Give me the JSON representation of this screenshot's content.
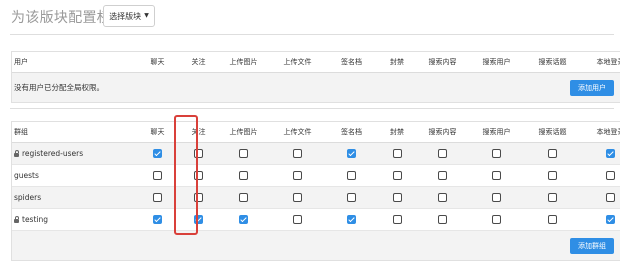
{
  "header": {
    "title": "为该版块配置权限：",
    "select_label": "选择版块"
  },
  "columns": [
    "聊天",
    "关注",
    "上传图片",
    "上传文件",
    "签名档",
    "封禁",
    "搜索内容",
    "搜索用户",
    "搜索话题",
    "本地登录"
  ],
  "users_panel": {
    "first_header": "用户",
    "empty_text": "没有用户已分配全局权限。",
    "add_button": "添加用户"
  },
  "groups_panel": {
    "first_header": "群组",
    "add_button": "添加群组",
    "rows": [
      {
        "name": "registered-users",
        "locked": true,
        "perms": [
          true,
          false,
          false,
          false,
          true,
          false,
          false,
          false,
          false,
          true
        ]
      },
      {
        "name": "guests",
        "locked": false,
        "perms": [
          false,
          false,
          false,
          false,
          false,
          false,
          false,
          false,
          false,
          false
        ]
      },
      {
        "name": "spiders",
        "locked": false,
        "perms": [
          false,
          false,
          false,
          false,
          false,
          false,
          false,
          false,
          false,
          false
        ]
      },
      {
        "name": "testing",
        "locked": true,
        "perms": [
          true,
          true,
          true,
          false,
          true,
          false,
          false,
          false,
          false,
          true
        ]
      }
    ]
  },
  "colors": {
    "accent": "#2f8ee5",
    "highlight": "#d9403a"
  }
}
